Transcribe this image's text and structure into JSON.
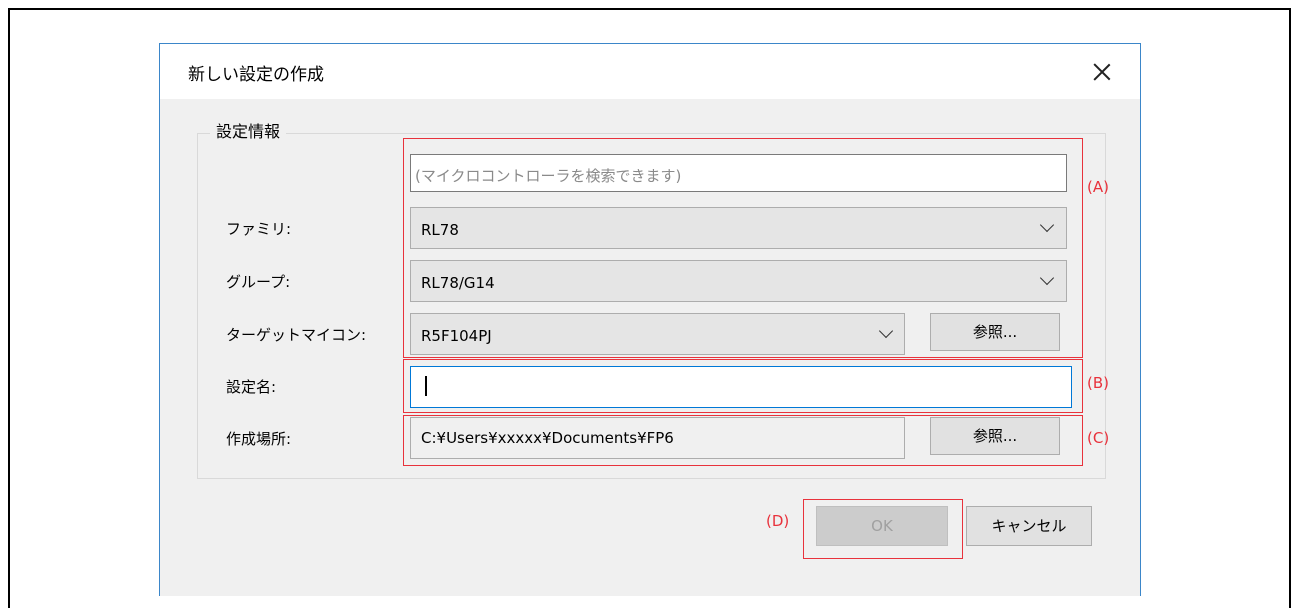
{
  "dialog": {
    "title": "新しい設定の作成"
  },
  "group": {
    "title": "設定情報"
  },
  "search": {
    "placeholder": "(マイクロコントローラを検索できます)"
  },
  "fields": {
    "family_label": "ファミリ:",
    "family_value": "RL78",
    "group_label": "グループ:",
    "group_value": "RL78/G14",
    "target_label": "ターゲットマイコン:",
    "target_value": "R5F104PJ",
    "browse_label": "参照...",
    "name_label": "設定名:",
    "name_value": "",
    "location_label": "作成場所:",
    "location_value": "C:¥Users¥xxxxx¥Documents¥FP6",
    "browse_label_2": "参照..."
  },
  "annotations": {
    "a": "(A)",
    "b": "(B)",
    "c": "(C)",
    "d": "(D)"
  },
  "buttons": {
    "ok": "OK",
    "cancel": "キャンセル"
  },
  "colors": {
    "highlight": "#e8323c",
    "focus": "#0078d7"
  }
}
